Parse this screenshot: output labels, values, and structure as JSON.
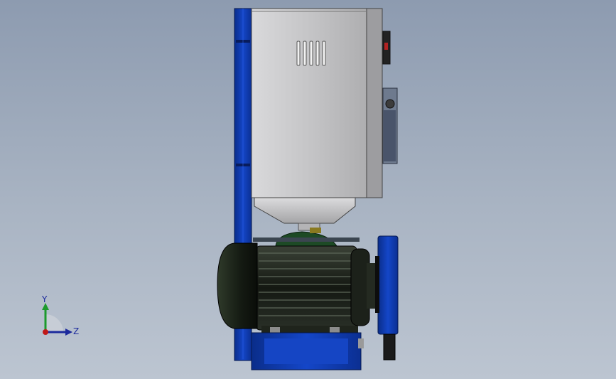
{
  "view": {
    "background_top": "#8d9bb0",
    "background_bottom": "#bcc5d1"
  },
  "model": {
    "frame_color": "#1240b8",
    "housing_color": "#b9b9bb",
    "motor_color": "#1b2019",
    "gearbox_color": "#1d4a25",
    "vent_slots": 5
  },
  "triad": {
    "y_label": "Y",
    "z_label": "Z",
    "y_color": "#1c9a2c",
    "z_color": "#1c2a9c",
    "origin_color": "#c01818"
  }
}
